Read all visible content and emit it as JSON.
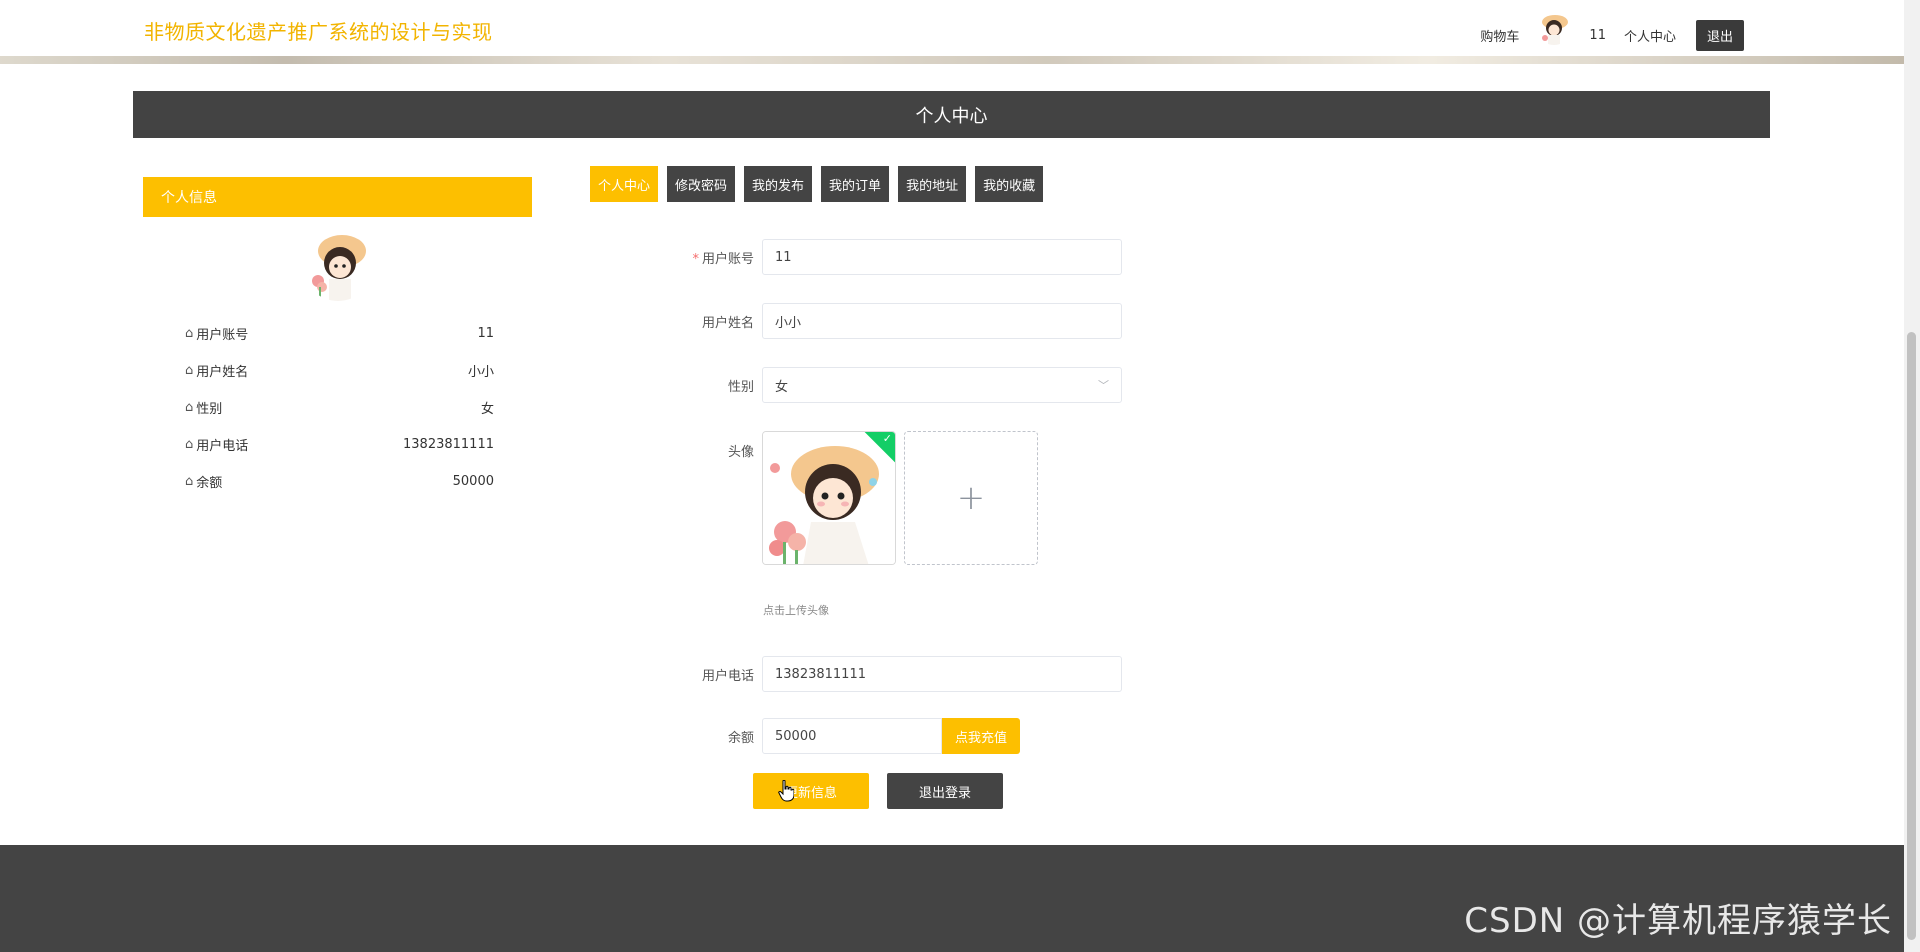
{
  "header": {
    "site_title": "非物质文化遗产推广系统的设计与实现",
    "cart_label": "购物车",
    "username": "11",
    "profile_label": "个人中心",
    "logout_label": "退出"
  },
  "banner": {
    "title": "个人中心"
  },
  "info_panel": {
    "title": "个人信息",
    "rows": [
      {
        "label": "用户账号",
        "value": "11"
      },
      {
        "label": "用户姓名",
        "value": "小小"
      },
      {
        "label": "性别",
        "value": "女"
      },
      {
        "label": "用户电话",
        "value": "13823811111"
      },
      {
        "label": "余额",
        "value": "50000"
      }
    ]
  },
  "tabs": [
    {
      "label": "个人中心",
      "active": true
    },
    {
      "label": "修改密码",
      "active": false
    },
    {
      "label": "我的发布",
      "active": false
    },
    {
      "label": "我的订单",
      "active": false
    },
    {
      "label": "我的地址",
      "active": false
    },
    {
      "label": "我的收藏",
      "active": false
    }
  ],
  "form": {
    "account": {
      "label": "用户账号",
      "value": "11"
    },
    "name": {
      "label": "用户姓名",
      "value": "小小"
    },
    "gender": {
      "label": "性别",
      "value": "女"
    },
    "avatar": {
      "label": "头像",
      "tip": "点击上传头像",
      "add_glyph": "+"
    },
    "phone": {
      "label": "用户电话",
      "value": "13823811111"
    },
    "balance": {
      "label": "余额",
      "value": "50000",
      "recharge_label": "点我充值"
    }
  },
  "buttons": {
    "update_label": "更新信息",
    "logout_label": "退出登录"
  },
  "watermark": "CSDN @计算机程序猿学长",
  "colors": {
    "accent": "#fdbf00",
    "dark": "#444444",
    "title": "#f2b400",
    "success": "#13ce66"
  }
}
